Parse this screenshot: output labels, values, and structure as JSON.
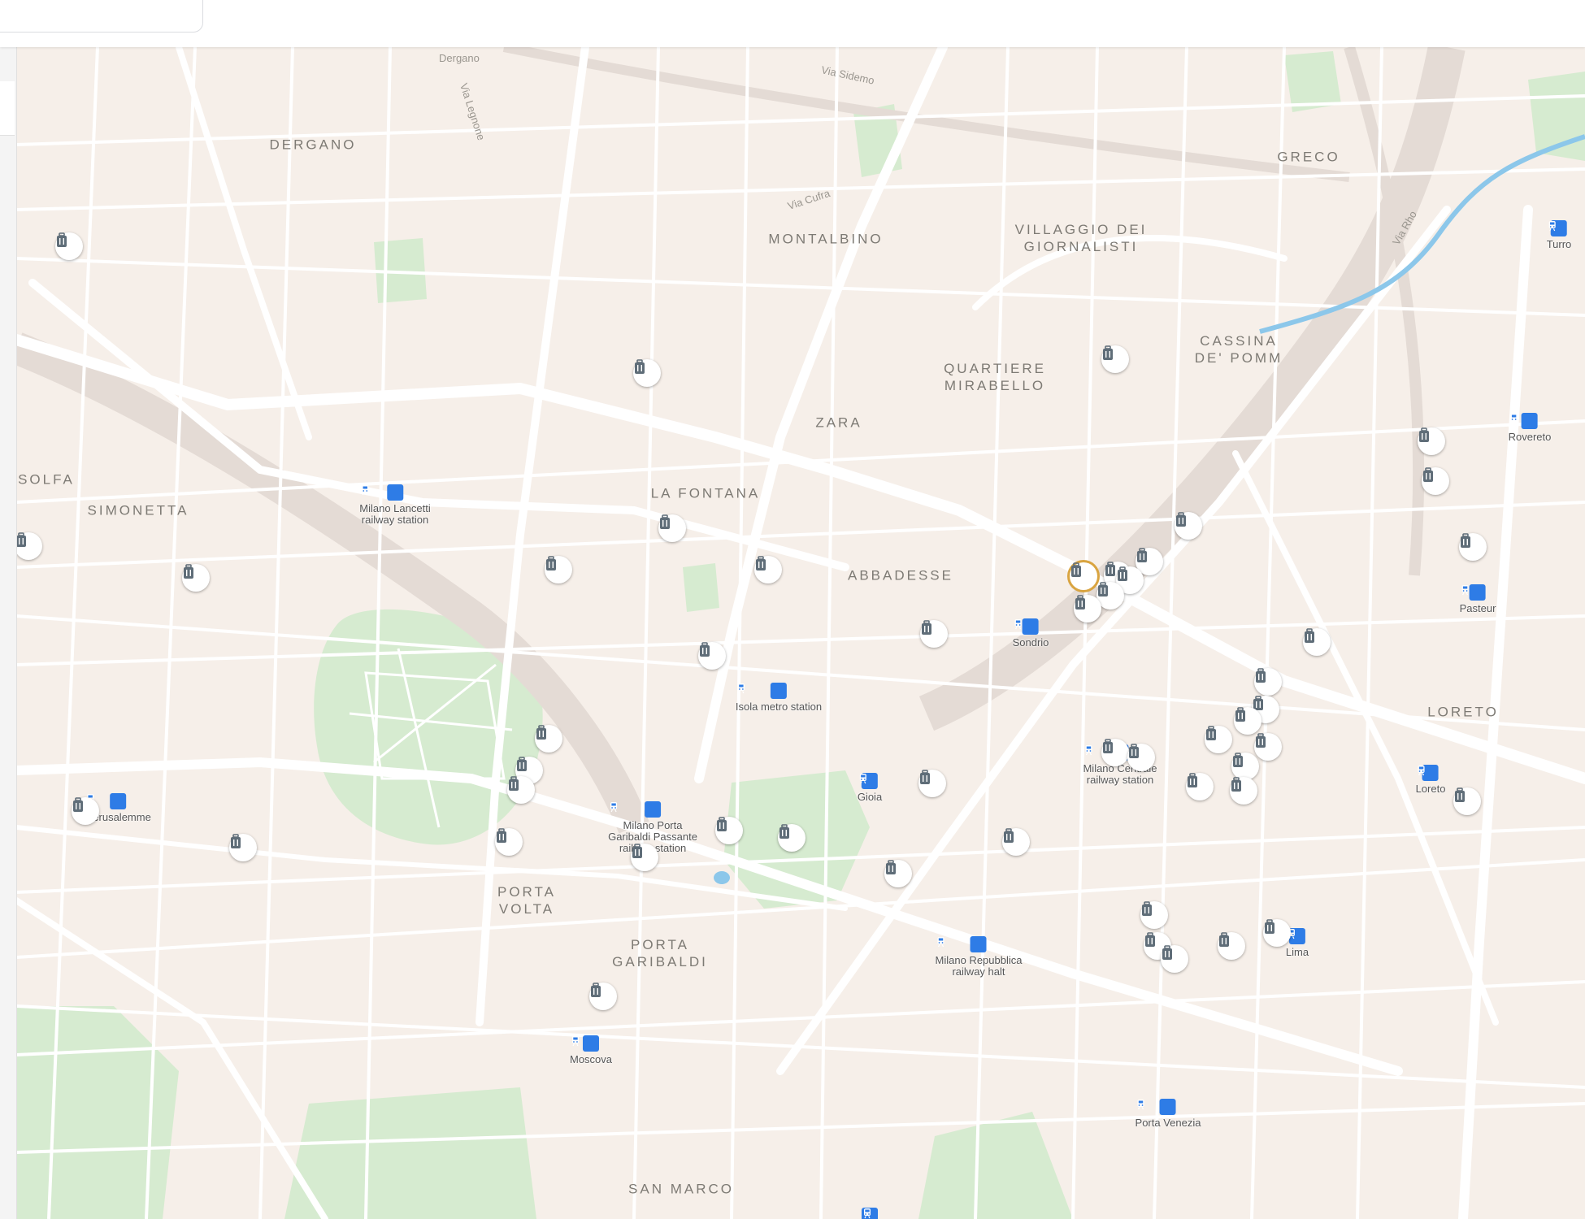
{
  "colors": {
    "land": "#f6efe9",
    "park": "#d6ebd0",
    "road": "#ffffff",
    "rail": "#e4dbd5",
    "water": "#8cc7ea",
    "station": "#2e7ce6",
    "marker_icon": "#5f6d78",
    "selected_ring": "#d9a440"
  },
  "search": {
    "placeholder": ""
  },
  "districts": [
    {
      "id": "dergano",
      "name": "DERGANO"
    },
    {
      "id": "greco",
      "name": "GRECO"
    },
    {
      "id": "montalbino",
      "name": "MONTALBINO"
    },
    {
      "id": "villaggio",
      "name": "VILLAGGIO DEI\nGIORNALISTI"
    },
    {
      "id": "cassina",
      "name": "CASSINA\nDE' POMM"
    },
    {
      "id": "mirabello",
      "name": "QUARTIERE\nMIRABELLO"
    },
    {
      "id": "zara",
      "name": "ZARA"
    },
    {
      "id": "solfa",
      "name": "SOLFA"
    },
    {
      "id": "simonetta",
      "name": "SIMONETTA"
    },
    {
      "id": "fontana",
      "name": "LA FONTANA"
    },
    {
      "id": "abbadesse",
      "name": "ABBADESSE"
    },
    {
      "id": "loreto",
      "name": "LORETO"
    },
    {
      "id": "porta_volta",
      "name": "PORTA\nVOLTA"
    },
    {
      "id": "porta_garibaldi",
      "name": "PORTA\nGARIBALDI"
    },
    {
      "id": "san_marco",
      "name": "SAN MARCO"
    }
  ],
  "streets": [
    {
      "id": "dergano_st",
      "name": "Dergano"
    },
    {
      "id": "sidemo",
      "name": "Via Sidemo"
    },
    {
      "id": "legnone",
      "name": "Via Legnone"
    },
    {
      "id": "cufra",
      "name": "Via Cufra"
    },
    {
      "id": "rho",
      "name": "Via Rho"
    }
  ],
  "stations": [
    {
      "id": "lancetti",
      "name": "Milano Lancetti\nrailway station"
    },
    {
      "id": "sondrio",
      "name": "Sondrio"
    },
    {
      "id": "isola",
      "name": "Isola metro station"
    },
    {
      "id": "centrale",
      "name": "Milano Centrale\nrailway station"
    },
    {
      "id": "gioia",
      "name": "Gioia"
    },
    {
      "id": "garibaldi",
      "name": "Milano Porta\nGaribaldi Passante\nrailway station"
    },
    {
      "id": "gerusalemme",
      "name": "Gerusalemme"
    },
    {
      "id": "repubblica",
      "name": "Milano Repubblica\nrailway halt"
    },
    {
      "id": "lima",
      "name": "Lima"
    },
    {
      "id": "loreto_st",
      "name": "Loreto"
    },
    {
      "id": "rovereto",
      "name": "Rovereto"
    },
    {
      "id": "turro",
      "name": "Turro"
    },
    {
      "id": "pasteur",
      "name": "Pasteur"
    },
    {
      "id": "moscova",
      "name": "Moscova"
    },
    {
      "id": "porta_venezia",
      "name": "Porta Venezia"
    },
    {
      "id": "bottom",
      "name": ""
    }
  ],
  "markers": {
    "icon": "luggage-icon",
    "selected_index": 13,
    "count": 57
  }
}
